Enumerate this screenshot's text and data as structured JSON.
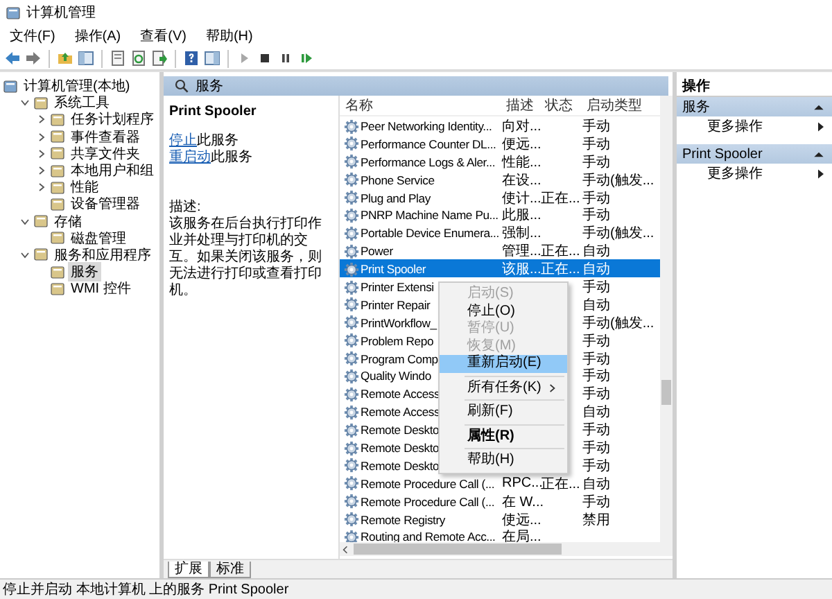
{
  "window": {
    "title": "计算机管理"
  },
  "menu": [
    "文件(F)",
    "操作(A)",
    "查看(V)",
    "帮助(H)"
  ],
  "tree": [
    {
      "label": "计算机管理(本地)",
      "selected": false,
      "children": [
        {
          "label": "系统工具",
          "expanded": true,
          "selected": false,
          "children": [
            {
              "label": "任务计划程序",
              "expanded": false,
              "selected": false
            },
            {
              "label": "事件查看器",
              "expanded": false,
              "selected": false
            },
            {
              "label": "共享文件夹",
              "expanded": false,
              "selected": false
            },
            {
              "label": "本地用户和组",
              "expanded": false,
              "selected": false
            },
            {
              "label": "性能",
              "expanded": false,
              "selected": false
            },
            {
              "label": "设备管理器",
              "selected": false
            }
          ]
        },
        {
          "label": "存储",
          "expanded": true,
          "selected": false,
          "children": [
            {
              "label": "磁盘管理",
              "selected": false
            }
          ]
        },
        {
          "label": "服务和应用程序",
          "expanded": true,
          "selected": false,
          "children": [
            {
              "label": "服务",
              "selected": true
            },
            {
              "label": "WMI 控件",
              "selected": false
            }
          ]
        }
      ]
    }
  ],
  "panel": {
    "title": "服务"
  },
  "detail": {
    "title": "Print Spooler",
    "links": [
      {
        "link": "停止",
        "rest": "此服务"
      },
      {
        "link": "重启动",
        "rest": "此服务"
      }
    ],
    "description_label": "描述:",
    "description": "该服务在后台执行打印作业并处理与打印机的交互。如果关闭该服务，则无法进行打印或查看打印机。"
  },
  "table": {
    "columns": [
      "名称",
      "描述",
      "状态",
      "启动类型"
    ],
    "rows": [
      {
        "cells": [
          "Peer Networking Identity...",
          "向对...",
          "",
          "手动"
        ],
        "selected": false
      },
      {
        "cells": [
          "Performance Counter DL...",
          "便远...",
          "",
          "手动"
        ],
        "selected": false
      },
      {
        "cells": [
          "Performance Logs & Aler...",
          "性能...",
          "",
          "手动"
        ],
        "selected": false
      },
      {
        "cells": [
          "Phone Service",
          "在设...",
          "",
          "手动(触发..."
        ],
        "selected": false
      },
      {
        "cells": [
          "Plug and Play",
          "使计...",
          "正在...",
          "手动"
        ],
        "selected": false
      },
      {
        "cells": [
          "PNRP Machine Name Pu...",
          "此服...",
          "",
          "手动"
        ],
        "selected": false
      },
      {
        "cells": [
          "Portable Device Enumera...",
          "强制...",
          "",
          "手动(触发..."
        ],
        "selected": false
      },
      {
        "cells": [
          "Power",
          "管理...",
          "正在...",
          "自动"
        ],
        "selected": false
      },
      {
        "cells": [
          "Print Spooler",
          "该服...",
          "正在...",
          "自动"
        ],
        "selected": true
      },
      {
        "cells": [
          "Printer Extensi",
          "",
          "",
          "手动"
        ],
        "selected": false
      },
      {
        "cells": [
          "Printer Repair",
          "",
          "",
          "自动"
        ],
        "selected": false
      },
      {
        "cells": [
          "PrintWorkflow_",
          "",
          "",
          "手动(触发..."
        ],
        "selected": false
      },
      {
        "cells": [
          "Problem Repo",
          "",
          "",
          "手动"
        ],
        "selected": false
      },
      {
        "cells": [
          "Program Comp",
          "",
          "",
          "手动"
        ],
        "selected": false
      },
      {
        "cells": [
          "Quality Windo",
          "",
          "",
          "手动"
        ],
        "selected": false
      },
      {
        "cells": [
          "Remote Access",
          "",
          "",
          "手动"
        ],
        "selected": false
      },
      {
        "cells": [
          "Remote Access",
          "",
          "",
          "自动"
        ],
        "selected": false
      },
      {
        "cells": [
          "Remote Deskto",
          "",
          "",
          "手动"
        ],
        "selected": false
      },
      {
        "cells": [
          "Remote Deskto",
          "",
          "",
          "手动"
        ],
        "selected": false
      },
      {
        "cells": [
          "Remote Deskto",
          "",
          "",
          "手动"
        ],
        "selected": false
      },
      {
        "cells": [
          "Remote Procedure Call (...",
          "RPC...",
          "正在...",
          "自动"
        ],
        "selected": false
      },
      {
        "cells": [
          "Remote Procedure Call (...",
          "在 W...",
          "",
          "手动"
        ],
        "selected": false
      },
      {
        "cells": [
          "Remote Registry",
          "使远...",
          "",
          "禁用"
        ],
        "selected": false
      },
      {
        "cells": [
          "Routing and Remote Acc...",
          "在局...",
          "",
          ""
        ],
        "selected": false
      }
    ]
  },
  "context_menu": [
    {
      "kind": "item",
      "label": "启动(S)",
      "disabled": true,
      "selected": false
    },
    {
      "kind": "item",
      "label": "停止(O)",
      "disabled": false,
      "selected": false
    },
    {
      "kind": "item",
      "label": "暂停(U)",
      "disabled": true,
      "selected": false
    },
    {
      "kind": "item",
      "label": "恢复(M)",
      "disabled": true,
      "selected": false
    },
    {
      "kind": "item",
      "label": "重新启动(E)",
      "disabled": false,
      "selected": true
    },
    {
      "kind": "separator"
    },
    {
      "kind": "submenu",
      "label": "所有任务(K)",
      "disabled": false,
      "selected": false
    },
    {
      "kind": "separator"
    },
    {
      "kind": "item",
      "label": "刷新(F)",
      "disabled": false,
      "selected": false
    },
    {
      "kind": "separator"
    },
    {
      "kind": "default",
      "label": "属性(R)",
      "disabled": false,
      "selected": false
    },
    {
      "kind": "separator"
    },
    {
      "kind": "item",
      "label": "帮助(H)",
      "disabled": false,
      "selected": false
    }
  ],
  "tabs": [
    {
      "label": "扩展",
      "selected": true
    },
    {
      "label": "标准",
      "selected": false
    }
  ],
  "actions": {
    "title": "操作",
    "sections": [
      {
        "title": "服务",
        "expanded": true,
        "items": [
          "更多操作"
        ]
      },
      {
        "title": "Print Spooler",
        "expanded": true,
        "items": [
          "更多操作"
        ]
      }
    ]
  },
  "status_bar": "停止并启动 本地计算机 上的服务 Print Spooler"
}
